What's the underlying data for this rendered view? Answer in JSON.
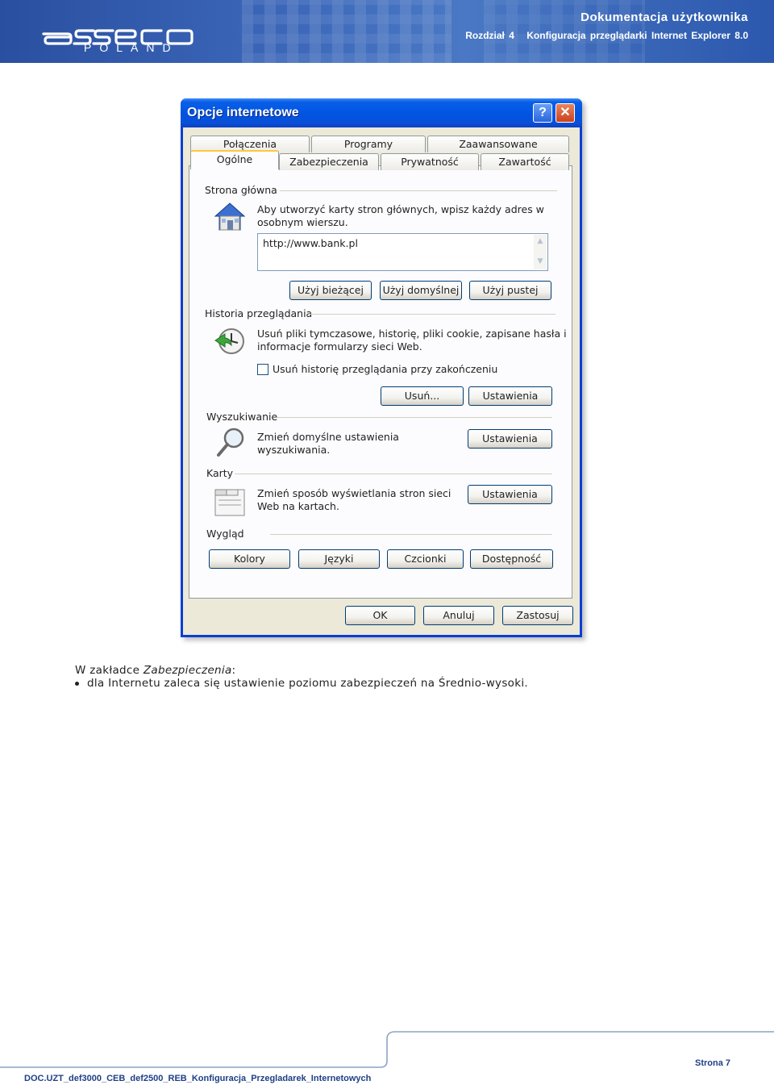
{
  "header": {
    "logo_sub": "POLAND",
    "doc_title": "Dokumentacja użytkownika",
    "chapter_number": "Rozdział 4",
    "chapter_title": "Konfiguracja przeglądarki Internet Explorer 8.0",
    "colors": {
      "banner": "#3b66b8",
      "text": "#ffffff"
    }
  },
  "dialog": {
    "title": "Opcje internetowe",
    "help_glyph": "?",
    "close_glyph": "✕",
    "tabs_row1": [
      "Połączenia",
      "Programy",
      "Zaawansowane"
    ],
    "tabs_row2": [
      "Ogólne",
      "Zabezpieczenia",
      "Prywatność",
      "Zawartość"
    ],
    "active_tab": "Ogólne",
    "homepage": {
      "label": "Strona główna",
      "description_line1": "Aby utworzyć karty stron głównych, wpisz każdy adres w",
      "description_line2": "osobnym wierszu.",
      "url_value": "http://www.bank.pl",
      "buttons": [
        "Użyj bieżącej",
        "Użyj domyślnej",
        "Użyj pustej"
      ]
    },
    "history": {
      "label": "Historia przeglądania",
      "description_line1": "Usuń pliki tymczasowe, historię, pliki cookie, zapisane hasła i",
      "description_line2": "informacje formularzy sieci Web.",
      "checkbox_label": "Usuń historię przeglądania przy zakończeniu",
      "checkbox_checked": false,
      "delete_button": "Usuń...",
      "settings_button": "Ustawienia"
    },
    "search": {
      "label": "Wyszukiwanie",
      "description_line1": "Zmień domyślne ustawienia",
      "description_line2": "wyszukiwania.",
      "settings_button": "Ustawienia"
    },
    "tabs_section": {
      "label": "Karty",
      "description_line1": "Zmień sposób wyświetlania stron sieci",
      "description_line2": "Web na kartach.",
      "settings_button": "Ustawienia"
    },
    "appearance": {
      "label": "Wygląd",
      "buttons": [
        "Kolory",
        "Języki",
        "Czcionki",
        "Dostępność"
      ]
    },
    "footer_buttons": [
      "OK",
      "Anuluj",
      "Zastosuj"
    ]
  },
  "body": {
    "intro_prefix": "W zakładce ",
    "intro_italic": "Zabezpieczenia",
    "intro_suffix": ":",
    "bullet_text": "dla Internetu zaleca się ustawienie poziomu zabezpieczeń na Średnio-wysoki."
  },
  "footer": {
    "page": "Strona 7",
    "doc_code": "DOC.UZT_def3000_CEB_def2500_REB_Konfiguracja_Przegladarek_Internetowych"
  }
}
